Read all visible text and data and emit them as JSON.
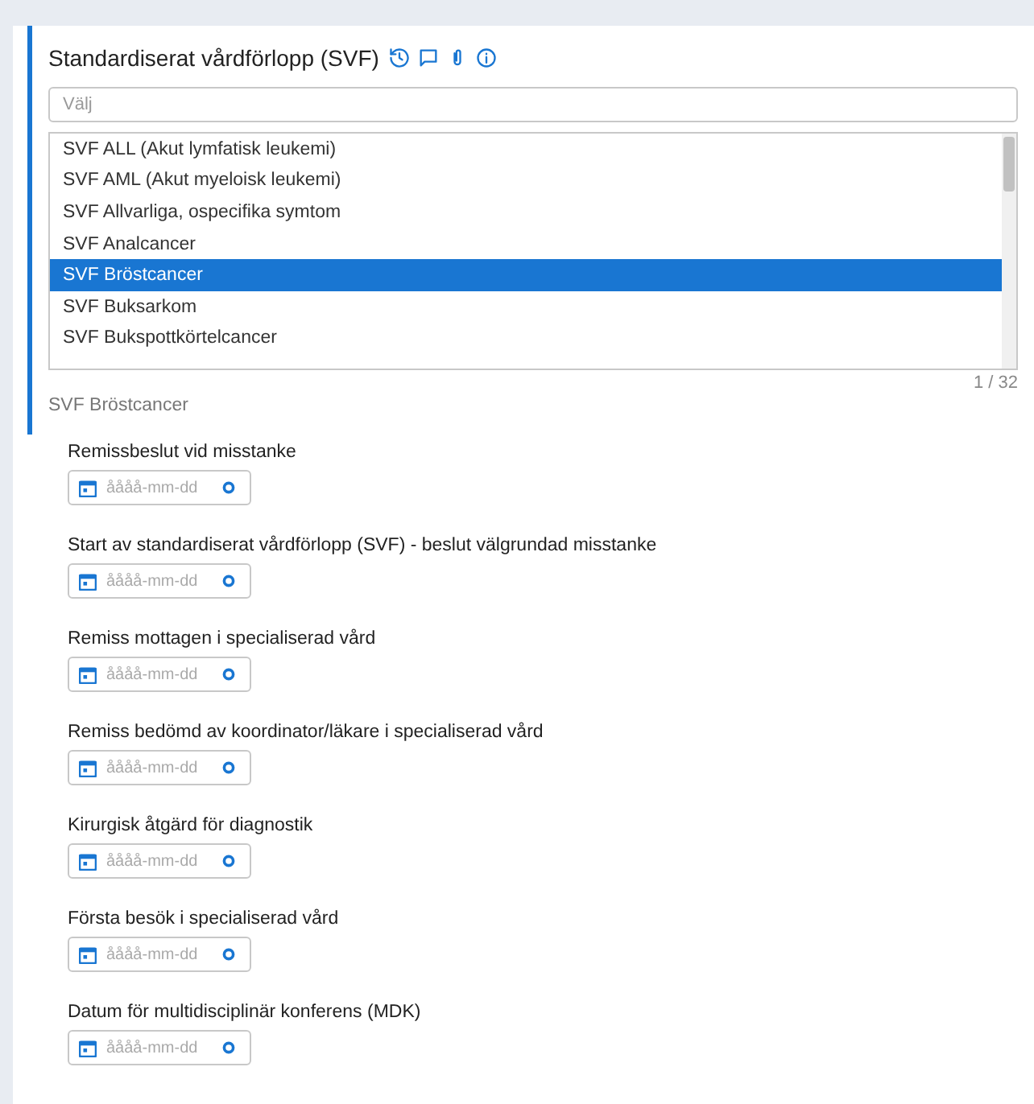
{
  "section": {
    "title": "Standardiserat vårdförlopp (SVF)"
  },
  "select": {
    "placeholder": "Välj"
  },
  "options": [
    {
      "label": "SVF ALL (Akut lymfatisk leukemi)",
      "selected": false
    },
    {
      "label": "SVF AML (Akut myeloisk leukemi)",
      "selected": false
    },
    {
      "label": "SVF Allvarliga, ospecifika symtom",
      "selected": false
    },
    {
      "label": "SVF Analcancer",
      "selected": false
    },
    {
      "label": "SVF Bröstcancer",
      "selected": true
    },
    {
      "label": "SVF Buksarkom",
      "selected": false
    },
    {
      "label": "SVF Bukspottkörtelcancer",
      "selected": false
    }
  ],
  "counter": "1 / 32",
  "chosen": "SVF Bröstcancer",
  "dates": [
    {
      "label": "Remissbeslut vid misstanke",
      "placeholder": "åååå-mm-dd"
    },
    {
      "label": "Start av standardiserat vårdförlopp (SVF) - beslut välgrundad misstanke",
      "placeholder": "åååå-mm-dd"
    },
    {
      "label": "Remiss mottagen i specialiserad vård",
      "placeholder": "åååå-mm-dd"
    },
    {
      "label": "Remiss bedömd av koordinator/läkare i specialiserad vård",
      "placeholder": "åååå-mm-dd"
    },
    {
      "label": "Kirurgisk åtgärd för diagnostik",
      "placeholder": "åååå-mm-dd"
    },
    {
      "label": "Första besök i specialiserad vård",
      "placeholder": "åååå-mm-dd"
    },
    {
      "label": "Datum för multidisciplinär konferens (MDK)",
      "placeholder": "åååå-mm-dd"
    }
  ]
}
